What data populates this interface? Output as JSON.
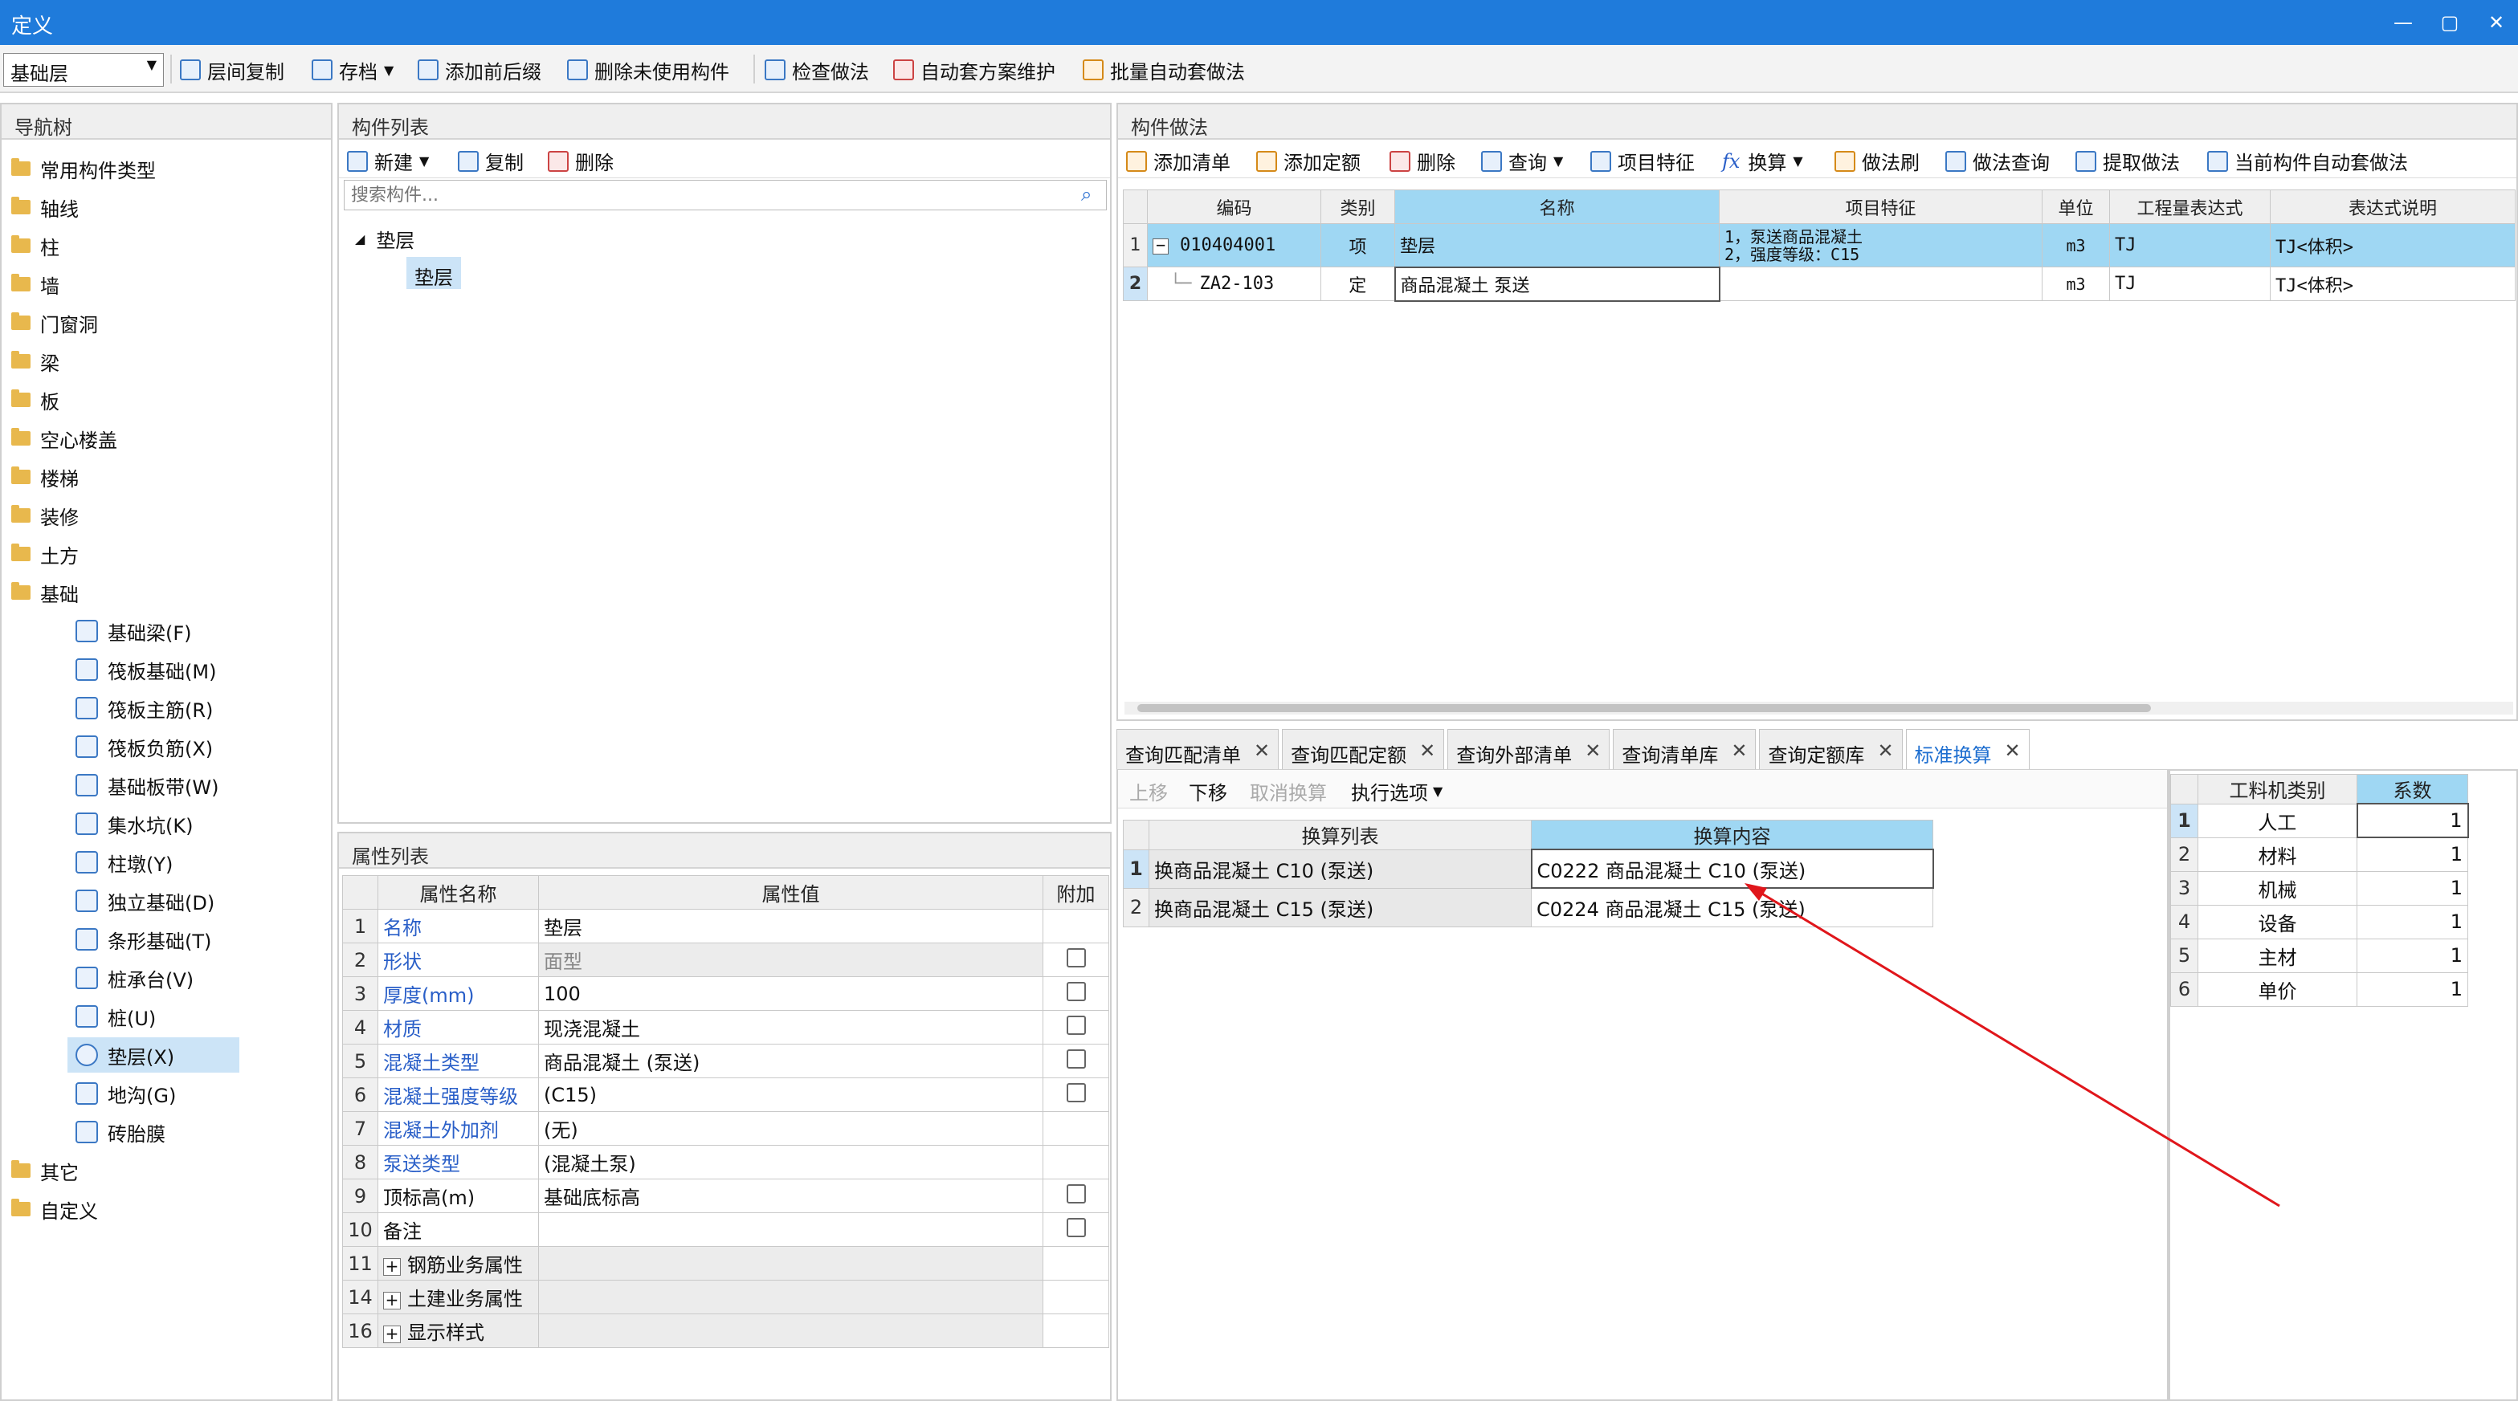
{
  "window": {
    "title": "定义"
  },
  "toolbar": {
    "floor_select": "基础层",
    "buttons": [
      "层间复制",
      "存档",
      "添加前后缀",
      "删除未使用构件",
      "检查做法",
      "自动套方案维护",
      "批量自动套做法"
    ]
  },
  "nav": {
    "title": "导航树",
    "items": [
      "常用构件类型",
      "轴线",
      "柱",
      "墙",
      "门窗洞",
      "梁",
      "板",
      "空心楼盖",
      "楼梯",
      "装修",
      "土方",
      "基础"
    ],
    "foundation_children": [
      "基础梁(F)",
      "筏板基础(M)",
      "筏板主筋(R)",
      "筏板负筋(X)",
      "基础板带(W)",
      "集水坑(K)",
      "柱墩(Y)",
      "独立基础(D)",
      "条形基础(T)",
      "桩承台(V)",
      "桩(U)",
      "垫层(X)",
      "地沟(G)",
      "砖胎膜"
    ],
    "tail_items": [
      "其它",
      "自定义"
    ]
  },
  "component_list": {
    "title": "构件列表",
    "new_label": "新建",
    "copy_label": "复制",
    "delete_label": "删除",
    "search_placeholder": "搜索构件...",
    "tree_parent": "垫层",
    "tree_child": "垫层"
  },
  "attributes": {
    "title": "属性列表",
    "headers": [
      "属性名称",
      "属性值",
      "附加"
    ],
    "rows": [
      {
        "no": "1",
        "name": "名称",
        "value": "垫层"
      },
      {
        "no": "2",
        "name": "形状",
        "value": "面型"
      },
      {
        "no": "3",
        "name": "厚度(mm)",
        "value": "100"
      },
      {
        "no": "4",
        "name": "材质",
        "value": "现浇混凝土"
      },
      {
        "no": "5",
        "name": "混凝土类型",
        "value": "商品混凝土 (泵送)"
      },
      {
        "no": "6",
        "name": "混凝土强度等级",
        "value": "(C15)"
      },
      {
        "no": "7",
        "name": "混凝土外加剂",
        "value": "(无)"
      },
      {
        "no": "8",
        "name": "泵送类型",
        "value": "(混凝土泵)"
      },
      {
        "no": "9",
        "name": "顶标高(m)",
        "value": "基础底标高"
      },
      {
        "no": "10",
        "name": "备注",
        "value": ""
      },
      {
        "no": "11",
        "name": "钢筋业务属性",
        "value": ""
      },
      {
        "no": "14",
        "name": "土建业务属性",
        "value": ""
      },
      {
        "no": "16",
        "name": "显示样式",
        "value": ""
      }
    ]
  },
  "method": {
    "title": "构件做法",
    "toolbar": [
      "添加清单",
      "添加定额",
      "删除",
      "查询",
      "项目特征",
      "换算",
      "做法刷",
      "做法查询",
      "提取做法",
      "当前构件自动套做法"
    ],
    "headers": [
      "编码",
      "类别",
      "名称",
      "项目特征",
      "单位",
      "工程量表达式",
      "表达式说明"
    ],
    "rows": [
      {
        "no": "1",
        "code": "010404001",
        "type": "项",
        "name": "垫层",
        "feature1": "1，泵送商品混凝土",
        "feature2": "2，强度等级：C15",
        "unit": "m3",
        "expr": "TJ",
        "desc": "TJ<体积>"
      },
      {
        "no": "2",
        "code": "ZA2-103",
        "type": "定",
        "name": "商品混凝土 泵送",
        "feature1": "",
        "feature2": "",
        "unit": "m3",
        "expr": "TJ",
        "desc": "TJ<体积>"
      }
    ]
  },
  "bottom_tabs": [
    "查询匹配清单",
    "查询匹配定额",
    "查询外部清单",
    "查询清单库",
    "查询定额库",
    "标准换算"
  ],
  "conversion": {
    "toolbar": [
      "上移",
      "下移",
      "取消换算",
      "执行选项"
    ],
    "headers": [
      "换算列表",
      "换算内容"
    ],
    "rows": [
      {
        "no": "1",
        "list": "换商品混凝土 C10 (泵送)",
        "content": "C0222  商品混凝土 C10 (泵送)"
      },
      {
        "no": "2",
        "list": "换商品混凝土 C15 (泵送)",
        "content": "C0224  商品混凝土 C15 (泵送)"
      }
    ]
  },
  "factors": {
    "headers": [
      "工料机类别",
      "系数"
    ],
    "rows": [
      {
        "no": "1",
        "cat": "人工",
        "val": "1"
      },
      {
        "no": "2",
        "cat": "材料",
        "val": "1"
      },
      {
        "no": "3",
        "cat": "机械",
        "val": "1"
      },
      {
        "no": "4",
        "cat": "设备",
        "val": "1"
      },
      {
        "no": "5",
        "cat": "主材",
        "val": "1"
      },
      {
        "no": "6",
        "cat": "单价",
        "val": "1"
      }
    ]
  },
  "colors": {
    "title_bar": "#1f7bdb",
    "selected_row": "#9fd7f3",
    "annotation_arrow": "#e0161b"
  }
}
